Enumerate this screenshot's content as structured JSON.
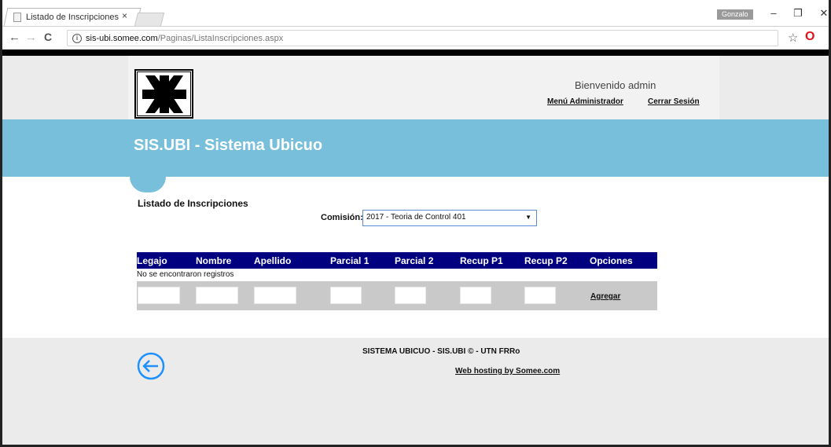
{
  "browser": {
    "tab_title": "Listado de Inscripciones",
    "tab_close": "×",
    "profile_name": "Gonzalo",
    "url_host": "sis-ubi.somee.com",
    "url_path": "/Paginas/ListaInscripciones.aspx",
    "win_minimize": "–",
    "win_restore": "❐",
    "win_close": "✕",
    "back": "←",
    "forward": "→",
    "reload": "C",
    "info": "i",
    "bookmark": "☆",
    "opera": "O",
    "menu": "⋮"
  },
  "header": {
    "welcome": "Bienvenido admin",
    "menu_admin": "Menú Administrador",
    "logout": "Cerrar Sesión"
  },
  "banner": {
    "title": "SIS.UBI - Sistema Ubicuo"
  },
  "main": {
    "section_title": "Listado de Inscripciones",
    "comision_label": "Comisión:",
    "comision_value": "2017 - Teoria de Control 401",
    "select_arrow": "▼"
  },
  "grid": {
    "columns": [
      "Legajo",
      "Nombre",
      "Apellido",
      "Parcial 1",
      "Parcial 2",
      "Recup P1",
      "Recup P2",
      "Opciones"
    ],
    "empty_message": "No se encontraron registros",
    "add_label": "Agregar"
  },
  "footer": {
    "text": "SISTEMA UBICUO - SIS.UBI © - UTN FRRo",
    "hosting": "Web hosting by Somee.com"
  },
  "colors": {
    "banner": "#78bfdb",
    "grid_header": "#000080",
    "accent_icon": "#1e90ff"
  }
}
